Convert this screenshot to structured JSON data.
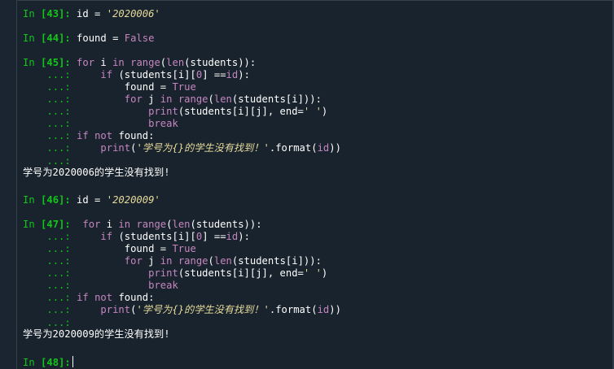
{
  "prompt_in": "In ",
  "cont": "...:",
  "cells": [
    {
      "n": "[43]:",
      "rest": " id = ",
      "str": "'2020006'"
    },
    {
      "n": "[44]:",
      "rest": " found = ",
      "bool": "False"
    },
    {
      "n": "[45]:"
    },
    {
      "n": "[46]:",
      "rest": " id = ",
      "str": "'2020009'"
    },
    {
      "n": "[47]:"
    },
    {
      "n": "[48]:"
    }
  ],
  "block": {
    "l1a": "for",
    "l1b": " i ",
    "l1c": "in",
    "l1d": " ",
    "l1e": "range",
    "l1f": "(",
    "l1g": "len",
    "l1h": "(students)):",
    "l2a": "    ",
    "l2b": "if",
    "l2c": " (students[i][",
    "l2d": "0",
    "l2e": "] ==",
    "l2f": "id",
    "l2g": "):",
    "l3a": "        found = ",
    "l3b": "True",
    "l4a": "        ",
    "l4b": "for",
    "l4c": " j ",
    "l4d": "in",
    "l4e": " ",
    "l4f": "range",
    "l4g": "(",
    "l4h": "len",
    "l4i": "(students[i])):",
    "l5a": "            ",
    "l5b": "print",
    "l5c": "(students[i][j], end=",
    "l5d": "' '",
    "l5e": ")",
    "l6a": "            ",
    "l6b": "break",
    "l7a": "if",
    "l7b": " ",
    "l7c": "not",
    "l7d": " found:",
    "l8a": "    ",
    "l8b": "print",
    "l8c": "(",
    "l8d": "'学号为{}的学生没有找到！'",
    "l8e": ".format(",
    "l8f": "id",
    "l8g": "))"
  },
  "outputs": {
    "out1": "学号为2020006的学生没有找到!",
    "out2": "学号为2020009的学生没有找到!"
  }
}
